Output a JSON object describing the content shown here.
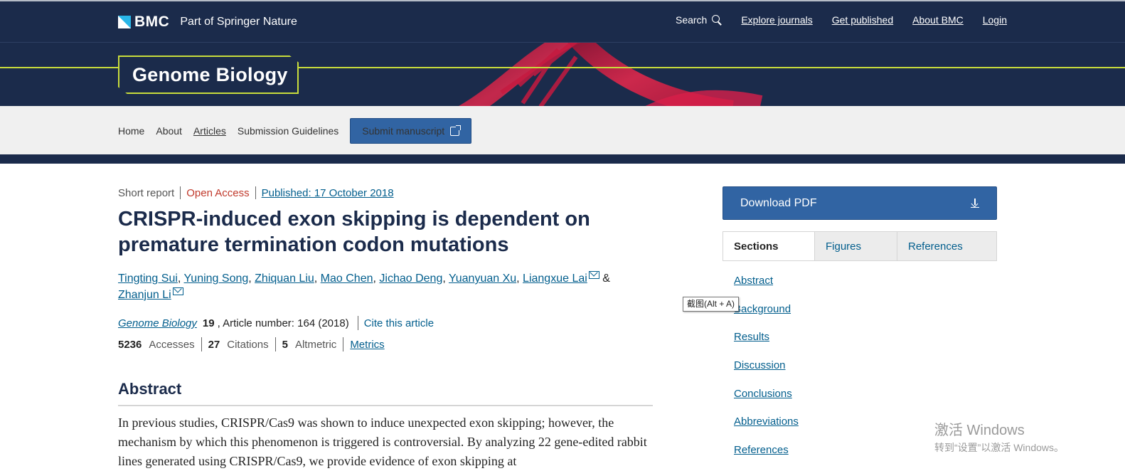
{
  "header": {
    "brand": "BMC",
    "brand_sub": "Part of Springer Nature",
    "search_label": "Search",
    "nav": [
      "Explore journals",
      "Get published",
      "About BMC",
      "Login"
    ]
  },
  "banner": {
    "journal_name": "Genome Biology"
  },
  "subnav": {
    "items": [
      "Home",
      "About",
      "Articles",
      "Submission Guidelines"
    ],
    "submit_label": "Submit manuscript"
  },
  "article": {
    "type": "Short report",
    "access": "Open Access",
    "published": "Published: 17 October 2018",
    "title": "CRISPR-induced exon skipping is dependent on premature termination codon mutations",
    "authors": [
      "Tingting Sui",
      "Yuning Song",
      "Zhiquan Liu",
      "Mao Chen",
      "Jichao Deng",
      "Yuanyuan Xu",
      "Liangxue Lai",
      "Zhanjun Li"
    ],
    "author_amp": "&",
    "journal": "Genome Biology",
    "volume": "19",
    "article_number": ", Article number: 164 (2018)",
    "cite_label": "Cite this article",
    "accesses_count": "5236",
    "accesses_label": "Accesses",
    "citations_count": "27",
    "citations_label": "Citations",
    "altmetric_count": "5",
    "altmetric_label": "Altmetric",
    "metrics_label": "Metrics",
    "abstract_heading": "Abstract",
    "abstract_text": "In previous studies, CRISPR/Cas9 was shown to induce unexpected exon skipping; however, the mechanism by which this phenomenon is triggered is controversial. By analyzing 22 gene-edited rabbit lines generated using CRISPR/Cas9, we provide evidence of exon skipping at"
  },
  "sidebar": {
    "download_label": "Download PDF",
    "tabs": [
      "Sections",
      "Figures",
      "References"
    ],
    "sections": [
      "Abstract",
      "Background",
      "Results",
      "Discussion",
      "Conclusions",
      "Abbreviations",
      "References"
    ]
  },
  "overlay": {
    "tooltip": "截图(Alt + A)",
    "watermark_line1": "激活 Windows",
    "watermark_line2": "转到“设置”以激活 Windows。"
  },
  "colors": {
    "navy": "#1b2b4b",
    "accent_lime": "#c8dc3c",
    "button_blue": "#3164a3",
    "link_blue": "#025e8d",
    "open_access_red": "#c0392b"
  }
}
